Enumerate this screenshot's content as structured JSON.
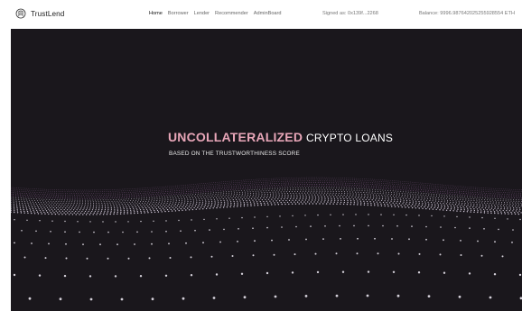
{
  "header": {
    "brand": "TrustLend",
    "nav": [
      {
        "label": "Home",
        "active": true
      },
      {
        "label": "Borrower",
        "active": false
      },
      {
        "label": "Lender",
        "active": false
      },
      {
        "label": "Recommender",
        "active": false
      },
      {
        "label": "AdminBoard",
        "active": false
      }
    ],
    "signed_as": "Signed as: 0x139f...2268",
    "balance": "Balance: 9996.987642025255928554 ETH"
  },
  "hero": {
    "headline_highlight": "UNCOLLATERALIZED",
    "headline_rest": "CRYPTO LOANS",
    "subline": "BASED ON THE TRUSTWORTHINESS SCORE",
    "colors": {
      "background": "#1a171c",
      "accent": "#e8a6b8",
      "wave": "#b07ab8"
    }
  }
}
